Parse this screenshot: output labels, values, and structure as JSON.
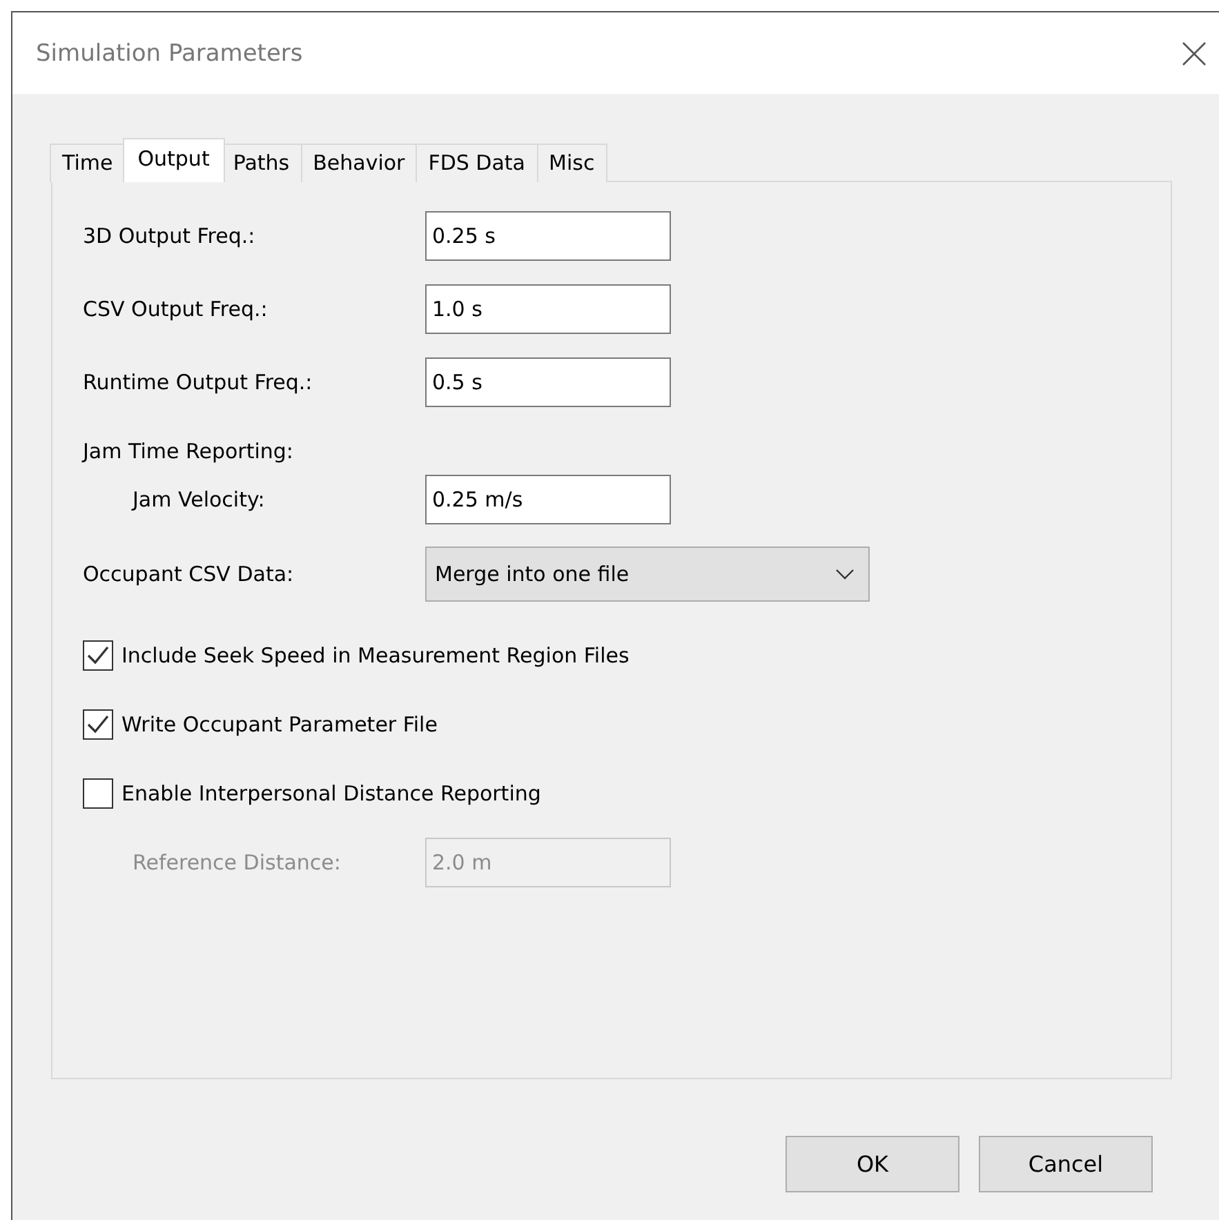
{
  "window": {
    "title": "Simulation Parameters"
  },
  "tabs": [
    {
      "label": "Time",
      "selected": false
    },
    {
      "label": "Output",
      "selected": true
    },
    {
      "label": "Paths",
      "selected": false
    },
    {
      "label": "Behavior",
      "selected": false
    },
    {
      "label": "FDS Data",
      "selected": false
    },
    {
      "label": "Misc",
      "selected": false
    }
  ],
  "rows": [
    {
      "kind": "field",
      "label": "3D Output Freq.:",
      "value": "0.25 s",
      "indented": false,
      "disabled": false
    },
    {
      "kind": "field",
      "label": "CSV Output Freq.:",
      "value": "1.0 s",
      "indented": false,
      "disabled": false
    },
    {
      "kind": "field",
      "label": "Runtime Output Freq.:",
      "value": "0.5 s",
      "indented": false,
      "disabled": false
    },
    {
      "kind": "heading",
      "label": "Jam Time Reporting:"
    },
    {
      "kind": "field",
      "label": "Jam Velocity:",
      "value": "0.25 m/s",
      "indented": true,
      "disabled": false
    },
    {
      "kind": "dropdown",
      "label": "Occupant CSV Data:",
      "value": "Merge into one file"
    },
    {
      "kind": "checkbox",
      "label": "Include Seek Speed in Measurement Region Files",
      "checked": true
    },
    {
      "kind": "checkbox",
      "label": "Write Occupant Parameter File",
      "checked": true
    },
    {
      "kind": "checkbox",
      "label": "Enable Interpersonal Distance Reporting",
      "checked": false
    },
    {
      "kind": "field",
      "label": "Reference Distance:",
      "value": "2.0 m",
      "indented": true,
      "disabled": true
    }
  ],
  "buttons": [
    "OK",
    "Cancel"
  ]
}
